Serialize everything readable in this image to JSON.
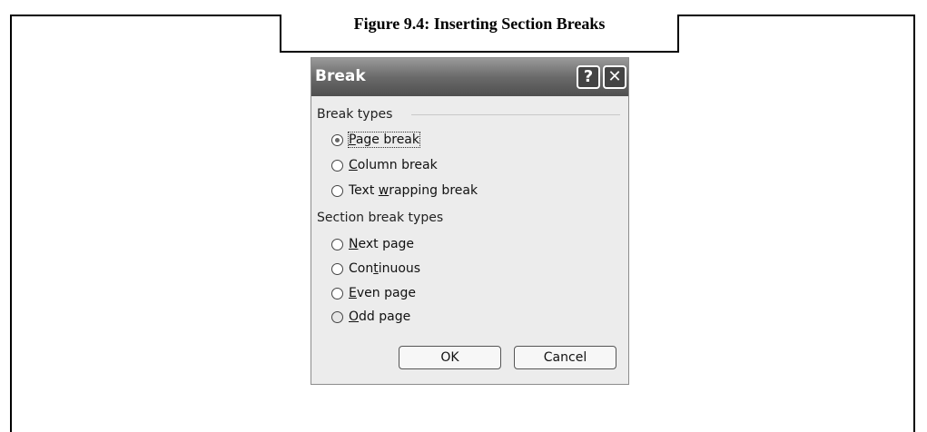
{
  "figure": {
    "caption": "Figure 9.4: Inserting Section Breaks"
  },
  "dialog": {
    "title": "Break",
    "help_glyph": "?",
    "close_glyph": "✕",
    "break_types_label": "Break types",
    "break_types": [
      {
        "pre": "",
        "mnemonic": "P",
        "post": "age break",
        "selected": true
      },
      {
        "pre": "",
        "mnemonic": "C",
        "post": "olumn break",
        "selected": false
      },
      {
        "pre": "Text ",
        "mnemonic": "w",
        "post": "rapping break",
        "selected": false
      }
    ],
    "section_label": "Section break types",
    "section_types": [
      {
        "pre": "",
        "mnemonic": "N",
        "post": "ext page",
        "selected": false
      },
      {
        "pre": "Con",
        "mnemonic": "t",
        "post": "inuous",
        "selected": false
      },
      {
        "pre": "",
        "mnemonic": "E",
        "post": "ven page",
        "selected": false
      },
      {
        "pre": "",
        "mnemonic": "O",
        "post": "dd page",
        "selected": false
      }
    ],
    "ok_label": "OK",
    "cancel_label": "Cancel"
  }
}
